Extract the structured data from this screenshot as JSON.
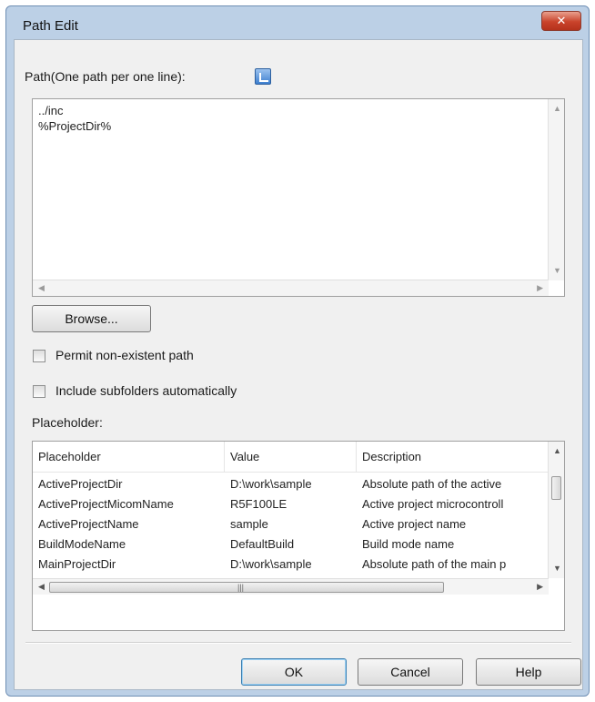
{
  "window": {
    "title": "Path Edit",
    "close_glyph": "✕"
  },
  "path_section": {
    "label": "Path(One path per one line):",
    "lines": "../inc\n%ProjectDir%"
  },
  "browse_button": "Browse...",
  "options": {
    "permit_nonexistent": {
      "label": "Permit non-existent path",
      "checked": false
    },
    "include_subfolders": {
      "label": "Include subfolders automatically",
      "checked": false
    }
  },
  "placeholder_section": {
    "label": "Placeholder:",
    "columns": [
      "Placeholder",
      "Value",
      "Description"
    ],
    "rows": [
      [
        "ActiveProjectDir",
        "D:\\work\\sample",
        "Absolute path of the active"
      ],
      [
        "ActiveProjectMicomName",
        "R5F100LE",
        "Active project microcontroll"
      ],
      [
        "ActiveProjectName",
        "sample",
        "Active project name"
      ],
      [
        "BuildModeName",
        "DefaultBuild",
        "Build mode name"
      ],
      [
        "MainProjectDir",
        "D:\\work\\sample",
        "Absolute path of the main p"
      ]
    ]
  },
  "footer": {
    "ok": "OK",
    "cancel": "Cancel",
    "help": "Help"
  },
  "icons": {
    "close": "close-icon",
    "path_help": "path-help-icon"
  }
}
